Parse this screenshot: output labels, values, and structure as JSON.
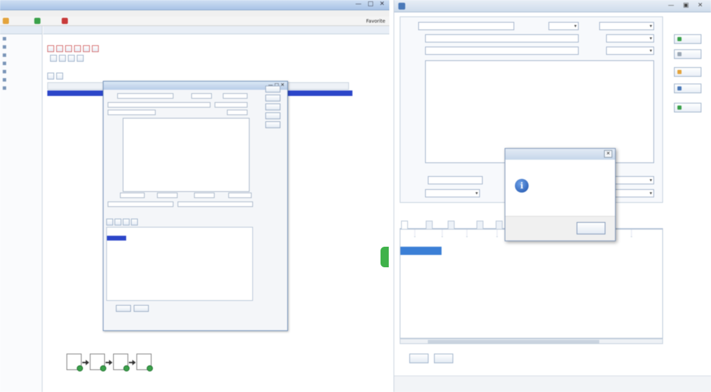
{
  "left": {
    "window_title": "",
    "menu": [
      "",
      "",
      "",
      "",
      "",
      ""
    ],
    "toolbar": {
      "refresh": "",
      "new": "",
      "delete": "",
      "favorites": "Favorite"
    },
    "sidebar": {
      "header": "",
      "items": [
        "",
        "",
        "",
        "",
        "",
        "",
        ""
      ]
    },
    "main": {
      "subheader": "",
      "path": "",
      "page_info": "",
      "action_buttons": [
        "",
        "",
        "",
        "",
        "",
        ""
      ],
      "filter_buttons": [
        "",
        "",
        "",
        ""
      ],
      "pager": "",
      "grid_tabs": [
        "",
        ""
      ],
      "columns": [
        "",
        "",
        "",
        "",
        "",
        "",
        ""
      ],
      "rows": [
        {
          "c1": "",
          "c2": "",
          "c3": "",
          "c4": "",
          "c5": "",
          "c6": "",
          "c7": "",
          "selected": true
        },
        {
          "c1": "",
          "c2": "",
          "c3": "",
          "c4": "",
          "c5": "",
          "c6": "",
          "c7": "",
          "selected": false
        },
        {
          "c1": "",
          "c2": "",
          "c3": "",
          "c4": "",
          "c5": "",
          "c6": "",
          "c7": "",
          "selected": false
        },
        {
          "c1": "",
          "c2": "",
          "c3": "",
          "c4": "",
          "c5": "",
          "c6": "",
          "c7": "",
          "selected": false
        },
        {
          "c1": "",
          "c2": "",
          "c3": "",
          "c4": "",
          "c5": "",
          "c6": "",
          "c7": "",
          "selected": false
        },
        {
          "c1": "",
          "c2": "",
          "c3": "",
          "c4": "",
          "c5": "",
          "c6": "",
          "c7": "",
          "selected": false
        },
        {
          "c1": "",
          "c2": "",
          "c3": "",
          "c4": "",
          "c5": "",
          "c6": "",
          "c7": "",
          "selected": false
        }
      ]
    },
    "flow_nodes": [
      "",
      "",
      "",
      ""
    ],
    "dialog": {
      "title": "",
      "number_label": "",
      "number_value": "",
      "type_label": "",
      "type_value": "",
      "status_label": "",
      "status_value": "",
      "name_value": "",
      "dept_value": "",
      "owner_label": "",
      "owner_value": "",
      "content_label": "",
      "content_lines": [
        "",
        "",
        "",
        "",
        "",
        "",
        "",
        "",
        "",
        "",
        "",
        "",
        "",
        "",
        "",
        ""
      ],
      "side_buttons": [
        "",
        "",
        "",
        "",
        ""
      ],
      "host_label": "",
      "host_value": "",
      "recorder_label": "",
      "recorder_value": "",
      "start_label": "",
      "start_value": "",
      "end_label": "",
      "end_value": "",
      "tabs": [
        "",
        "",
        "",
        ""
      ],
      "columns": [
        "",
        "",
        "",
        "",
        "",
        "",
        ""
      ],
      "rows": [
        {
          "code": "",
          "name": "",
          "phone": "",
          "mode": "",
          "state": ""
        },
        {
          "code": "",
          "name": "",
          "phone": "",
          "mode": "",
          "state": ""
        },
        {
          "code": "",
          "name": "",
          "phone": "",
          "mode": "",
          "state": ""
        },
        {
          "code": "",
          "name": "",
          "phone": "",
          "mode": "",
          "state": ""
        },
        {
          "code": "",
          "name": "",
          "phone": "",
          "mode": "",
          "state": ""
        },
        {
          "code": "",
          "name": "",
          "phone": "",
          "mode": "",
          "state": ""
        },
        {
          "code": "",
          "name": "",
          "phone": "",
          "mode": "",
          "state": ""
        },
        {
          "code": "",
          "name": "",
          "phone": "",
          "mode": "",
          "state": ""
        }
      ],
      "nav": [
        "",
        "",
        ""
      ],
      "buttons": [
        "",
        ""
      ]
    }
  },
  "right": {
    "window_title": "",
    "window_subtitle": "",
    "form": {
      "number_label": "",
      "number_value": "",
      "type_label": "",
      "type_value": "",
      "status_label": "",
      "status_value": "",
      "name_label": "",
      "name_value": "",
      "dept_label": "",
      "dept_value": "",
      "place_label": "",
      "place_value": "",
      "owner_label": "",
      "owner_value": "",
      "content_label": "",
      "content_lines": [
        "",
        "",
        "",
        "",
        "",
        "",
        "",
        "",
        "",
        "",
        "",
        "",
        "",
        "",
        "",
        "",
        "",
        ""
      ],
      "host_label": "",
      "host_value": "",
      "recorder_label": "",
      "recorder_value": "",
      "clerk_value": "",
      "start_label": "",
      "start_value": "",
      "end_label": "",
      "end_value": "",
      "end_time_value": ""
    },
    "tabs": [
      "",
      "",
      "",
      "",
      ""
    ],
    "grid": {
      "columns": [
        "",
        "",
        "",
        "",
        "",
        ""
      ],
      "rows": [
        {
          "code": "",
          "name": "",
          "phone": "",
          "mode": "",
          "state": ""
        },
        {
          "code": "",
          "name": "",
          "phone": "",
          "mode": "",
          "state": ""
        },
        {
          "code": "",
          "name": "",
          "phone": "",
          "mode": "",
          "state": ""
        },
        {
          "code": "",
          "name": "",
          "phone": "",
          "mode": "",
          "state": ""
        },
        {
          "code": "",
          "name": "",
          "phone": "",
          "mode": "",
          "state": ""
        },
        {
          "code": "",
          "name": "",
          "phone": "",
          "mode": "",
          "state": ""
        },
        {
          "code": "",
          "name": "",
          "phone": "",
          "mode": "",
          "state": ""
        },
        {
          "code": "",
          "name": "",
          "phone": "",
          "mode": "",
          "state": ""
        }
      ]
    },
    "bottom_buttons": [
      "",
      ""
    ],
    "side_buttons": [
      "",
      "",
      "",
      "",
      ""
    ],
    "nav": [
      "",
      "",
      ""
    ],
    "message_box": {
      "title": "",
      "message": "",
      "ok": ""
    }
  },
  "colors": {
    "selection": "#2c46c9",
    "grid_selection": "#3b7fd6",
    "accent_green": "#3fb24a",
    "titlebar": "#b8cde8"
  }
}
